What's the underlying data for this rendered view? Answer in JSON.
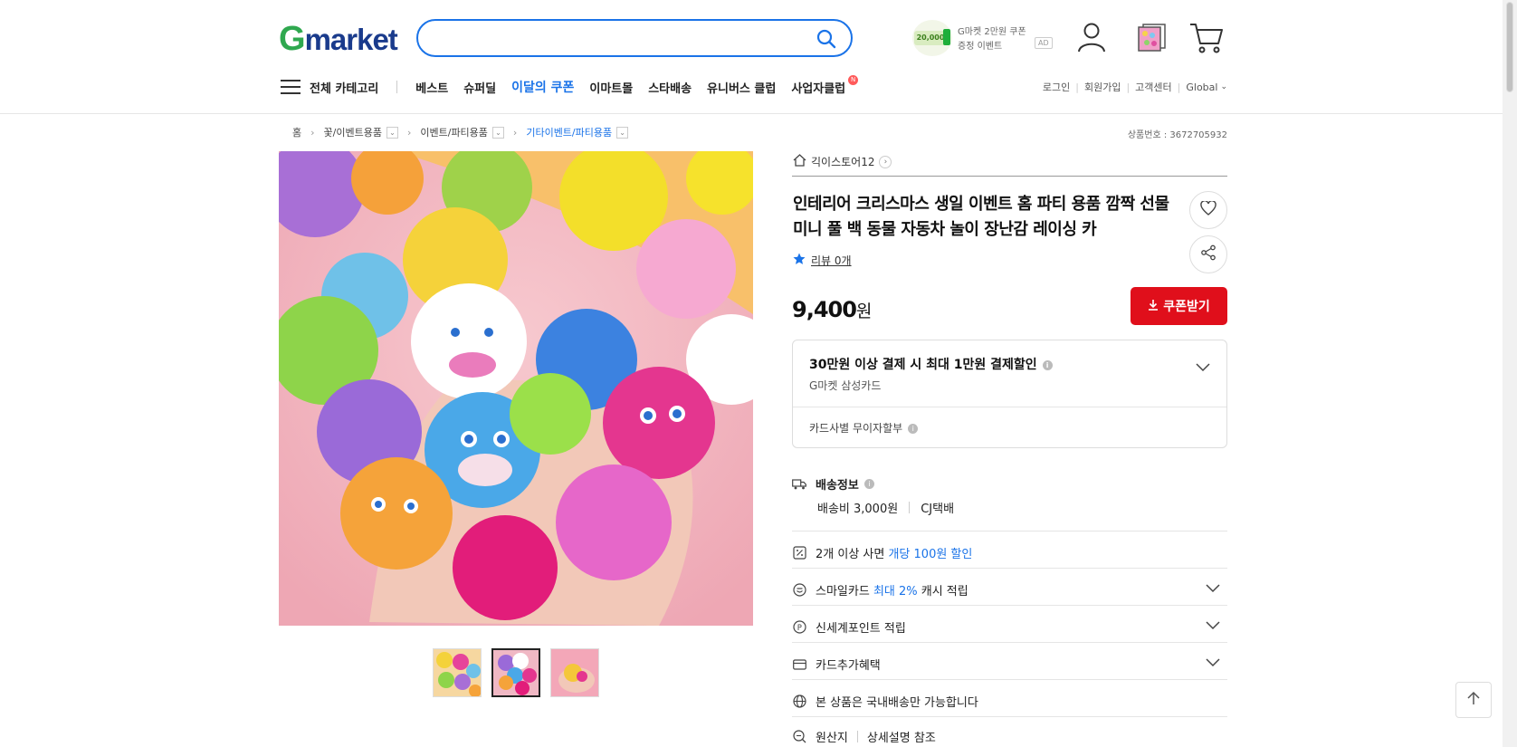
{
  "header": {
    "logo_g": "G",
    "logo_rest": "market",
    "search_placeholder": "",
    "ad": {
      "amount": "20,000",
      "line1": "G마켓 2만원 쿠폰",
      "line2": "증정 이벤트",
      "badge": "AD"
    }
  },
  "nav": {
    "all_categories": "전체 카테고리",
    "items": [
      "베스트",
      "슈퍼딜",
      "이달의 쿠폰",
      "이마트몰",
      "스타배송",
      "유니버스 클럽",
      "사업자클럽"
    ],
    "new_badge": "N",
    "util": [
      "로그인",
      "회원가입",
      "고객센터",
      "Global"
    ]
  },
  "breadcrumb": {
    "home": "홈",
    "levels": [
      "꽃/이벤트용품",
      "이벤트/파티용품",
      "기타이벤트/파티용품"
    ]
  },
  "product": {
    "id_text": "상품번호 : 3672705932",
    "store": "긱이스토어12",
    "title": "인테리어 크리스마스 생일 이벤트 홈 파티 용품 깜짝 선물 미니 풀 백 동물 자동차 놀이 장난감 레이싱 카",
    "review": "리뷰 0개",
    "price": "9,400",
    "currency": "원",
    "coupon_button": "쿠폰받기",
    "card_offer_title": "30만원 이상 결제 시 최대 1만원 결제할인",
    "card_offer_card": "G마켓 삼성카드",
    "installment": "카드사별 무이자할부",
    "shipping_title": "배송정보",
    "shipping_fee": "배송비 3,000원",
    "courier": "CJ택배",
    "multi_pre": "2개 이상 사면 ",
    "multi_hl": "개당 100원 할인",
    "smile_pre": "스마일카드 ",
    "smile_hl": "최대 2%",
    "smile_post": " 캐시 적립",
    "shinsegae": "신세계포인트 적립",
    "card_benefit": "카드추가혜택",
    "domestic": "본 상품은 국내배송만 가능합니다",
    "origin_label": "원산지",
    "origin_value": "상세설명 참조"
  },
  "colors": {
    "accent": "#1a73e8",
    "coupon_red": "#e00f1b",
    "logo_green": "#2fa84f",
    "logo_navy": "#1a3b8c"
  }
}
